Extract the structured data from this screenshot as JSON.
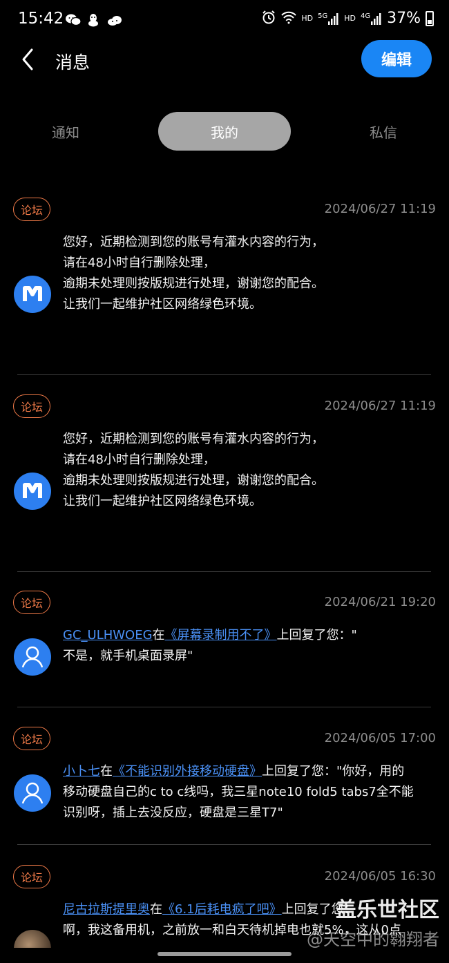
{
  "status_bar": {
    "time": "15:42",
    "hd1": "HD",
    "net1": "5G",
    "hd2": "HD",
    "net2": "4G",
    "battery": "37%"
  },
  "header": {
    "title": "消息",
    "edit_label": "编辑"
  },
  "tabs": [
    {
      "label": "通知",
      "active": false
    },
    {
      "label": "我的",
      "active": true
    },
    {
      "label": "私信",
      "active": false
    }
  ],
  "messages": [
    {
      "tag": "论坛",
      "date": "2024/06/27 11:19",
      "avatar": "app-logo-icon",
      "lines": [
        "您好，近期检测到您的账号有灌水内容的行为，",
        "请在48小时自行删除处理，",
        "逾期未处理则按版规进行处理，谢谢您的配合。",
        "让我们一起维护社区网络绿色环境。"
      ]
    },
    {
      "tag": "论坛",
      "date": "2024/06/27 11:19",
      "avatar": "app-logo-icon",
      "lines": [
        "您好，近期检测到您的账号有灌水内容的行为，",
        "请在48小时自行删除处理，",
        "逾期未处理则按版规进行处理，谢谢您的配合。",
        "让我们一起维护社区网络绿色环境。"
      ]
    },
    {
      "tag": "论坛",
      "date": "2024/06/21 19:20",
      "avatar": "user-icon",
      "user": "GC_ULHWOEG",
      "at": "在",
      "post": "《屏幕录制用不了》",
      "reply_prefix": "上回复了您：\"",
      "line2": "不是，就手机桌面录屏\""
    },
    {
      "tag": "论坛",
      "date": "2024/06/05 17:00",
      "avatar": "user-icon",
      "user": "小卜七",
      "at": "在",
      "post": "《不能识别外接移动硬盘》",
      "reply_prefix": "上回复了您：\"你好，用的",
      "line2": "移动硬盘自己的c to c线吗，我三星note10 fold5 tabs7全不能",
      "line3": "识别呀，插上去没反应，硬盘是三星T7\""
    },
    {
      "tag": "论坛",
      "date": "2024/06/05 16:30",
      "avatar": "user-photo",
      "user": "尼古拉斯提里奥",
      "at": "在",
      "post": "《6.1后耗电疯了吧》",
      "reply_prefix": "上回复了您：",
      "line2": "啊，我这备用机，之前放一和白天待机掉电也就5%，这从0点"
    }
  ],
  "watermark": {
    "main": "盖乐世社区",
    "sub": "@天空中的翱翔者"
  }
}
